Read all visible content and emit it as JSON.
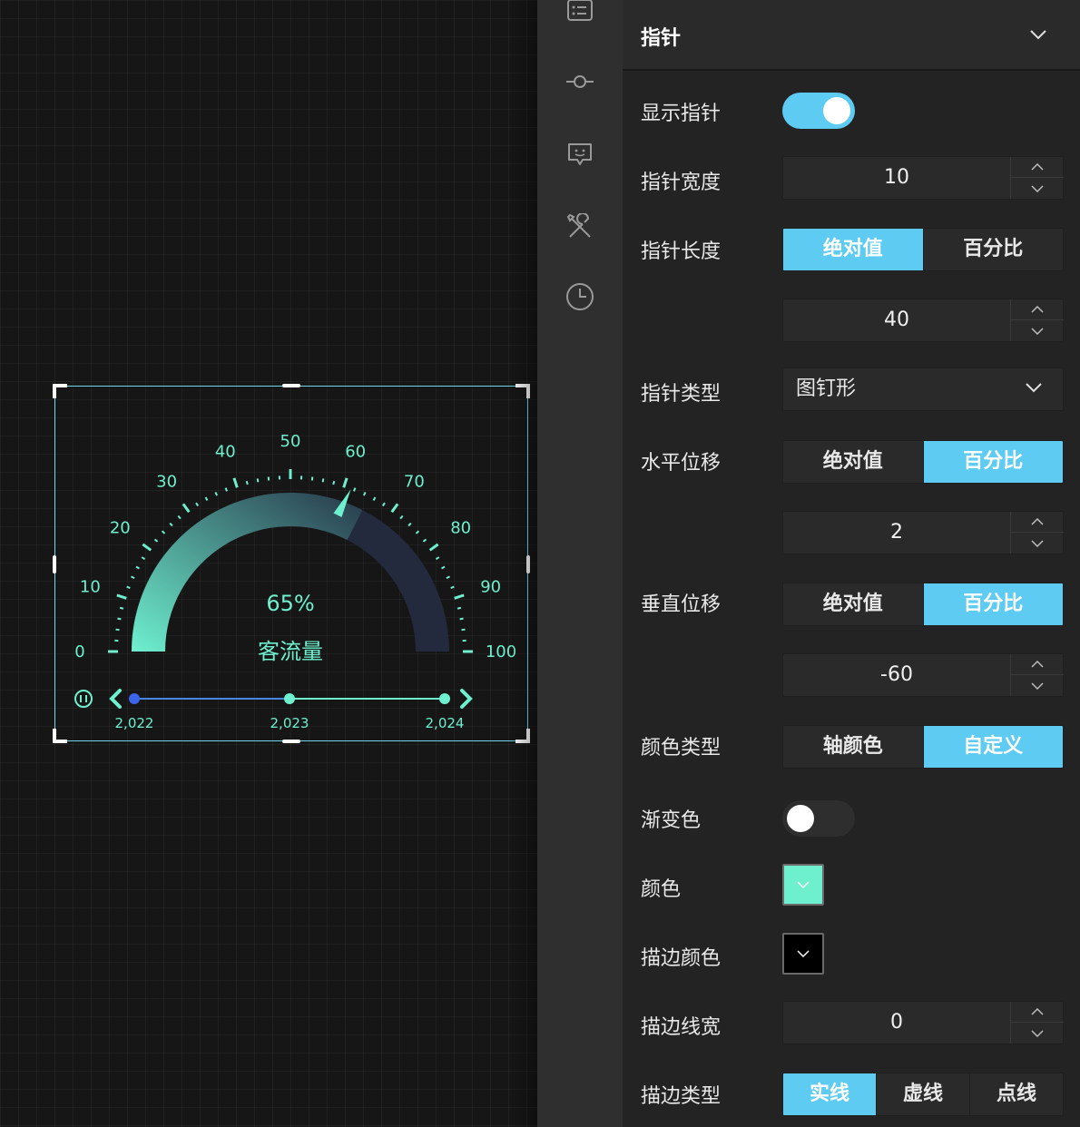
{
  "gauge": {
    "percent_label": "65%",
    "title": "客流量",
    "value": 65,
    "min": 0,
    "max": 100,
    "tick_labels": [
      "0",
      "10",
      "20",
      "30",
      "40",
      "50",
      "60",
      "70",
      "80",
      "90",
      "100"
    ],
    "colors": {
      "accent": "#6ef0cf",
      "track": "#232a3d",
      "gradient_start": "#6ef0cf",
      "gradient_end": "#2b4050"
    }
  },
  "timeline": {
    "years": [
      "2,022",
      "2,023",
      "2,024"
    ],
    "active_index": 0,
    "colors": {
      "active": "#3b64e8",
      "line": "#6ef0cf"
    }
  },
  "sidebar_icons": [
    "list-icon",
    "commit-icon",
    "chat-icon",
    "tools-icon",
    "clock-icon"
  ],
  "panel": {
    "title": "指针",
    "show_pointer": {
      "label": "显示指针",
      "on": true
    },
    "pointer_width": {
      "label": "指针宽度",
      "value": "10"
    },
    "pointer_length": {
      "label": "指针长度",
      "options": [
        "绝对值",
        "百分比"
      ],
      "selected": 0,
      "value": "40"
    },
    "pointer_type": {
      "label": "指针类型",
      "value": "图钉形"
    },
    "offset_x": {
      "label": "水平位移",
      "options": [
        "绝对值",
        "百分比"
      ],
      "selected": 1,
      "value": "2"
    },
    "offset_y": {
      "label": "垂直位移",
      "options": [
        "绝对值",
        "百分比"
      ],
      "selected": 1,
      "value": "-60"
    },
    "color_type": {
      "label": "颜色类型",
      "options": [
        "轴颜色",
        "自定义"
      ],
      "selected": 1
    },
    "gradient": {
      "label": "渐变色",
      "on": false
    },
    "color": {
      "label": "颜色",
      "value": "#6ef0cf"
    },
    "stroke_color": {
      "label": "描边颜色",
      "value": "#000000"
    },
    "stroke_width": {
      "label": "描边线宽",
      "value": "0"
    },
    "stroke_type": {
      "label": "描边类型",
      "options": [
        "实线",
        "虚线",
        "点线"
      ],
      "selected": 0
    },
    "accent": "#5ecbf3"
  }
}
